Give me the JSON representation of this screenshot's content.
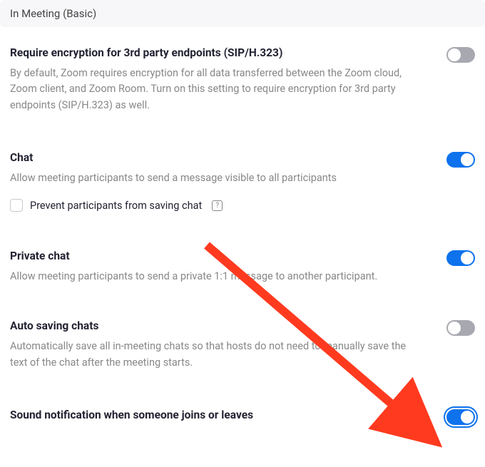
{
  "section_header": "In Meeting (Basic)",
  "settings": {
    "encryption": {
      "title": "Require encryption for 3rd party endpoints (SIP/H.323)",
      "desc": "By default, Zoom requires encryption for all data transferred between the Zoom cloud, Zoom client, and Zoom Room. Turn on this setting to require encryption for 3rd party endpoints (SIP/H.323) as well.",
      "on": false
    },
    "chat": {
      "title": "Chat",
      "desc": "Allow meeting participants to send a message visible to all participants",
      "on": true,
      "checkbox_label": "Prevent participants from saving chat",
      "checkbox_checked": false
    },
    "private_chat": {
      "title": "Private chat",
      "desc": "Allow meeting participants to send a private 1:1 message to another participant.",
      "on": true
    },
    "auto_save": {
      "title": "Auto saving chats",
      "desc": "Automatically save all in-meeting chats so that hosts do not need to manually save the text of the chat after the meeting starts.",
      "on": false
    },
    "sound_notification": {
      "title": "Sound notification when someone joins or leaves",
      "on": true,
      "focused": true
    }
  },
  "annotation": {
    "arrow_color": "#ff3a1f"
  }
}
